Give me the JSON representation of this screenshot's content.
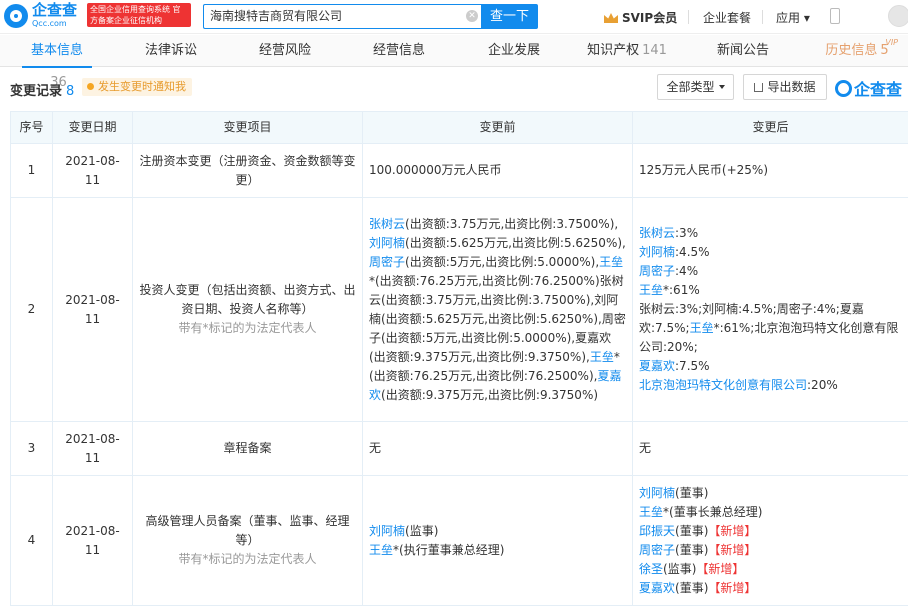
{
  "header": {
    "logo_cn": "企查查",
    "logo_en": "Qcc.com",
    "gov_badge": "全国企业信用查询系统 官方备案企业征信机构",
    "search_value": "海南搜特吉商贸有限公司",
    "search_button": "查一下",
    "svip": "SVIP会员",
    "suite": "企业套餐",
    "app": "应用",
    "icons": [
      "search-clear-icon",
      "crown-icon",
      "phone-icon",
      "avatar"
    ]
  },
  "tabs": [
    {
      "label": "基本信息",
      "count": "36",
      "active": true
    },
    {
      "label": "法律诉讼",
      "count": ""
    },
    {
      "label": "经营风险",
      "count": ""
    },
    {
      "label": "经营信息",
      "count": ""
    },
    {
      "label": "企业发展",
      "count": ""
    },
    {
      "label": "知识产权",
      "count": "141"
    },
    {
      "label": "新闻公告",
      "count": ""
    },
    {
      "label": "历史信息",
      "count": "5",
      "vip": "VIP"
    }
  ],
  "section": {
    "title": "变更记录",
    "count": "8",
    "notify": "发生变更时通知我",
    "filter": "全部类型",
    "export": "导出数据",
    "watermark": "企查查"
  },
  "table": {
    "headers": [
      "序号",
      "变更日期",
      "变更项目",
      "变更前",
      "变更后"
    ],
    "rows": [
      {
        "idx": "1",
        "date": "2021-08-11",
        "item": "注册资本变更（注册资金、资金数额等变更）",
        "note": "",
        "before": "100.000000万元人民币",
        "after": "125万元人民币(+25%)"
      },
      {
        "idx": "2",
        "date": "2021-08-11",
        "item": "投资人变更（包括出资额、出资方式、出资日期、投资人名称等）",
        "note": "带有*标记的为法定代表人",
        "before_parts": [
          {
            "t": "张树云",
            "c": "blu"
          },
          {
            "t": "(出资额:3.75万元,出资比例:3.7500%)",
            "c": ""
          },
          {
            "t": ",",
            "c": ""
          },
          {
            "t": "刘阿楠",
            "c": "blu"
          },
          {
            "t": "(出资额:5.625万元,出资比例:5.6250%)",
            "c": ""
          },
          {
            "t": ",",
            "c": ""
          },
          {
            "t": "周密子",
            "c": "blu"
          },
          {
            "t": "(出资额:5万元,出资比例:5.0000%)",
            "c": ""
          },
          {
            "t": ",",
            "c": ""
          },
          {
            "t": "王垒",
            "c": "blu"
          },
          {
            "t": "*(出资额:76.25万元,出资比例:76.2500%)",
            "c": ""
          },
          {
            "t": "张树云(出资额:3.75万元,出资比例:3.7500%),刘阿楠(出资额:5.625万元,出资比例:5.6250%),周密子(出资额:5万元,出资比例:5.0000%),夏嘉欢(出资额:9.375万元,出资比例:9.3750%),",
            "c": ""
          },
          {
            "t": "王垒",
            "c": "blu"
          },
          {
            "t": "*(出资额:76.25万元,出资比例:76.2500%)",
            "c": ""
          },
          {
            "t": ",",
            "c": ""
          },
          {
            "t": "夏嘉欢",
            "c": "blu"
          },
          {
            "t": "(出资额:9.375万元,出资比例:9.3750%)",
            "c": ""
          }
        ],
        "after_lines": [
          [
            {
              "t": "张树云",
              "c": "blu"
            },
            {
              "t": ":3%",
              "c": ""
            }
          ],
          [
            {
              "t": "刘阿楠",
              "c": "blu"
            },
            {
              "t": ":4.5%",
              "c": ""
            }
          ],
          [
            {
              "t": "周密子",
              "c": "blu"
            },
            {
              "t": ":4%",
              "c": ""
            }
          ],
          [
            {
              "t": "王垒",
              "c": "blu"
            },
            {
              "t": "*:61%",
              "c": ""
            }
          ],
          [
            {
              "t": "张树云:3%;刘阿楠:4.5%;周密子:4%;夏嘉欢:7.5%;",
              "c": ""
            },
            {
              "t": "王垒",
              "c": "blu"
            },
            {
              "t": "*:61%;北京泡泡玛特文化创意有限公司:20%;",
              "c": ""
            }
          ],
          [
            {
              "t": "夏嘉欢",
              "c": "blu"
            },
            {
              "t": ":7.5%",
              "c": ""
            }
          ],
          [
            {
              "t": "北京泡泡玛特文化创意有限公司",
              "c": "blu"
            },
            {
              "t": ":20%",
              "c": ""
            }
          ]
        ]
      },
      {
        "idx": "3",
        "date": "2021-08-11",
        "item": "章程备案",
        "note": "",
        "before": "无",
        "after": "无"
      },
      {
        "idx": "4",
        "date": "2021-08-11",
        "item": "高级管理人员备案（董事、监事、经理等）",
        "note": "带有*标记的为法定代表人",
        "before_lines": [
          [
            {
              "t": "刘阿楠",
              "c": "blu"
            },
            {
              "t": "(监事)",
              "c": ""
            }
          ],
          [
            {
              "t": "王垒",
              "c": "blu"
            },
            {
              "t": "*(执行董事兼总经理)",
              "c": ""
            }
          ]
        ],
        "after_lines": [
          [
            {
              "t": "刘阿楠",
              "c": "blu"
            },
            {
              "t": "(董事)",
              "c": ""
            }
          ],
          [
            {
              "t": "王垒",
              "c": "blu"
            },
            {
              "t": "*(董事长兼总经理)",
              "c": ""
            }
          ],
          [
            {
              "t": "邱振天",
              "c": "blu"
            },
            {
              "t": "(董事)",
              "c": ""
            },
            {
              "t": "【新增】",
              "c": "new"
            }
          ],
          [
            {
              "t": "周密子",
              "c": "blu"
            },
            {
              "t": "(董事)",
              "c": ""
            },
            {
              "t": "【新增】",
              "c": "new"
            }
          ],
          [
            {
              "t": "徐圣",
              "c": "blu"
            },
            {
              "t": "(监事)",
              "c": ""
            },
            {
              "t": "【新增】",
              "c": "new"
            }
          ],
          [
            {
              "t": "夏嘉欢",
              "c": "blu"
            },
            {
              "t": "(董事)",
              "c": ""
            },
            {
              "t": "【新增】",
              "c": "new"
            }
          ]
        ]
      }
    ]
  }
}
